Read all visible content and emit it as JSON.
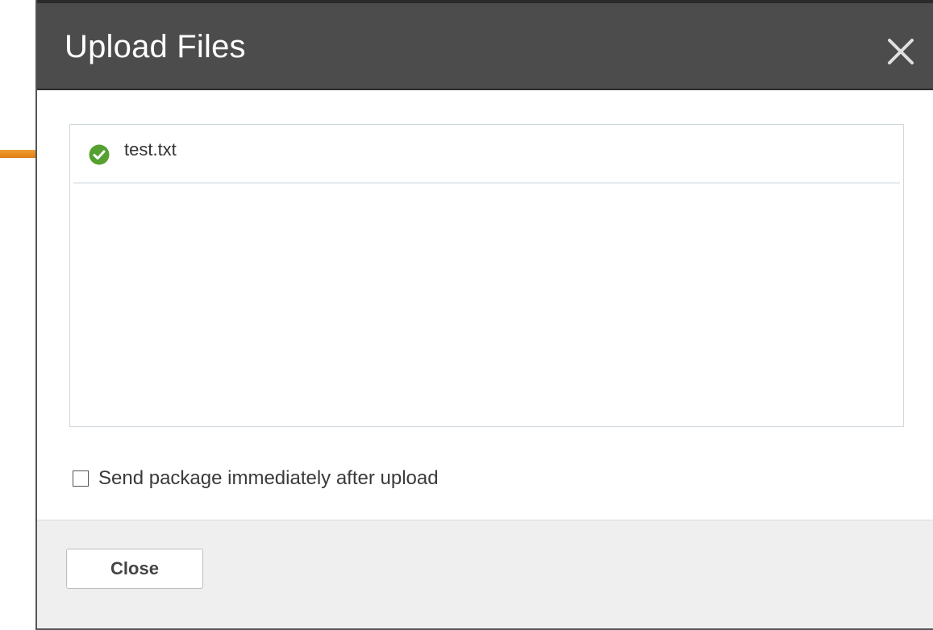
{
  "dialog": {
    "title": "Upload Files",
    "close_icon": "close-icon"
  },
  "files": [
    {
      "name": "test.txt",
      "status_icon": "check-circle-icon",
      "status_color": "#56a030"
    }
  ],
  "options": {
    "send_immediately_label": "Send package immediately after upload",
    "send_immediately_checked": false
  },
  "footer": {
    "close_label": "Close"
  },
  "annotation": {
    "arrow_icon": "arrow-right-icon",
    "arrow_color": "#e88a1a"
  },
  "colors": {
    "header_bg": "#4c4c4c",
    "footer_bg": "#efefef"
  }
}
